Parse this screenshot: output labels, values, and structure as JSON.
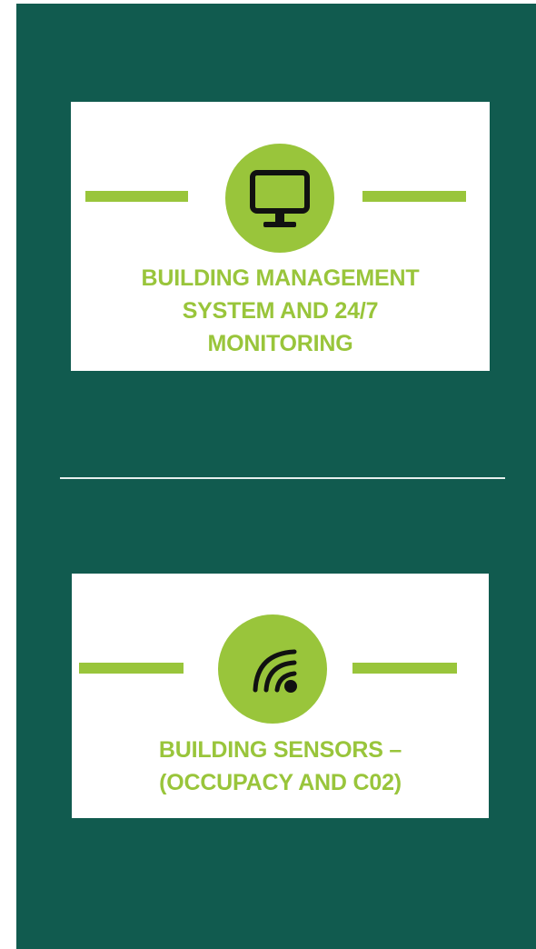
{
  "cards": [
    {
      "icon": "monitor-icon",
      "title": "BUILDING MANAGEMENT\nSYSTEM AND 24/7\nMONITORING"
    },
    {
      "icon": "wireless-signal-icon",
      "title": "BUILDING SENSORS –\n(OCCUPACY AND C02)"
    }
  ],
  "colors": {
    "background": "#115b4f",
    "accent": "#99c53b",
    "card": "#ffffff",
    "icon": "#111111"
  }
}
